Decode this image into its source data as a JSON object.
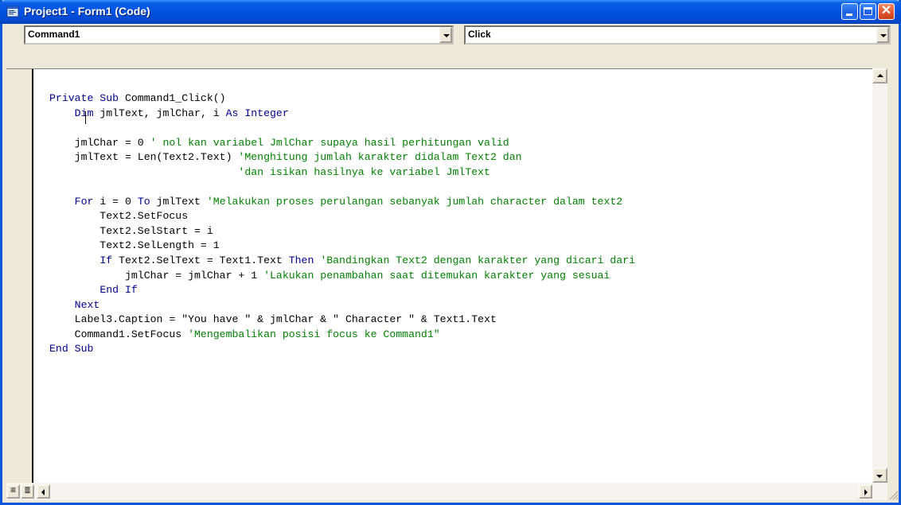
{
  "window": {
    "title": "Project1 - Form1 (Code)"
  },
  "object_combo": {
    "value": "Command1"
  },
  "procedure_combo": {
    "value": "Click"
  },
  "code": {
    "lines": [
      [
        {
          "t": "Private Sub ",
          "c": "kw"
        },
        {
          "t": "Command1_Click()",
          "c": ""
        }
      ],
      [
        {
          "t": "    ",
          "c": ""
        },
        {
          "t": "Dim",
          "c": "kw"
        },
        {
          "t": " jmlText, jmlChar, i ",
          "c": ""
        },
        {
          "t": "As Integer",
          "c": "kw"
        }
      ],
      [],
      [
        {
          "t": "    jmlChar = 0 ",
          "c": ""
        },
        {
          "t": "' nol kan variabel JmlChar supaya hasil perhitungan valid",
          "c": "cm"
        }
      ],
      [
        {
          "t": "    jmlText = Len(Text2.Text) ",
          "c": ""
        },
        {
          "t": "'Menghitung jumlah karakter didalam Text2 dan",
          "c": "cm"
        }
      ],
      [
        {
          "t": "                              ",
          "c": ""
        },
        {
          "t": "'dan isikan hasilnya ke variabel JmlText",
          "c": "cm"
        }
      ],
      [],
      [
        {
          "t": "    ",
          "c": ""
        },
        {
          "t": "For",
          "c": "kw"
        },
        {
          "t": " i = 0 ",
          "c": ""
        },
        {
          "t": "To",
          "c": "kw"
        },
        {
          "t": " jmlText ",
          "c": ""
        },
        {
          "t": "'Melakukan proses perulangan sebanyak jumlah character dalam text2",
          "c": "cm"
        }
      ],
      [
        {
          "t": "        Text2.SetFocus",
          "c": ""
        }
      ],
      [
        {
          "t": "        Text2.SelStart = i",
          "c": ""
        }
      ],
      [
        {
          "t": "        Text2.SelLength = 1",
          "c": ""
        }
      ],
      [
        {
          "t": "        ",
          "c": ""
        },
        {
          "t": "If",
          "c": "kw"
        },
        {
          "t": " Text2.SelText = Text1.Text ",
          "c": ""
        },
        {
          "t": "Then",
          "c": "kw"
        },
        {
          "t": " ",
          "c": ""
        },
        {
          "t": "'Bandingkan Text2 dengan karakter yang dicari dari",
          "c": "cm"
        }
      ],
      [
        {
          "t": "            jmlChar = jmlChar + 1 ",
          "c": ""
        },
        {
          "t": "'Lakukan penambahan saat ditemukan karakter yang sesuai",
          "c": "cm"
        }
      ],
      [
        {
          "t": "        ",
          "c": ""
        },
        {
          "t": "End If",
          "c": "kw"
        }
      ],
      [
        {
          "t": "    ",
          "c": ""
        },
        {
          "t": "Next",
          "c": "kw"
        }
      ],
      [
        {
          "t": "    Label3.Caption = \"You have \" & jmlChar & \" Character \" & Text1.Text",
          "c": ""
        }
      ],
      [
        {
          "t": "    Command1.SetFocus ",
          "c": ""
        },
        {
          "t": "'Mengembalikan posisi focus ke Command1\"",
          "c": "cm"
        }
      ],
      [
        {
          "t": "End Sub",
          "c": "kw"
        }
      ]
    ]
  },
  "colors": {
    "keyword": "#00008b",
    "comment": "#008000",
    "code_text": "#000000",
    "titlebar": "#0054e3"
  },
  "icons": {
    "window_icon": "vb-code-window-icon",
    "minimize": "minimize-icon",
    "maximize": "maximize-icon",
    "close": "close-icon",
    "procedure_view": "procedure-view-icon",
    "full_module_view": "full-module-view-icon"
  }
}
